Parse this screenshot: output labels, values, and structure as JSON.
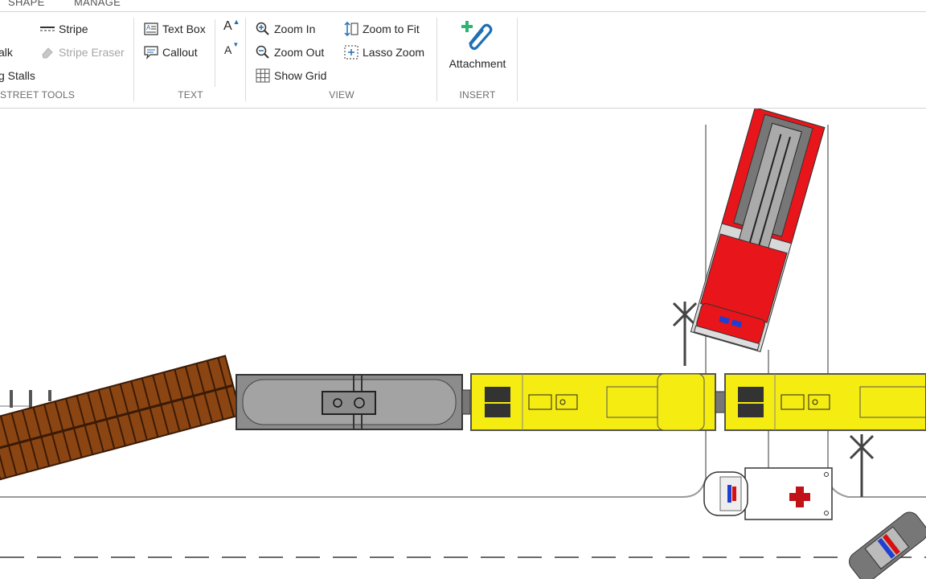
{
  "ribbon": {
    "tabs": [
      "SHAPE",
      "MANAGE"
    ],
    "street_tools": {
      "label": "STREET TOOLS",
      "items": [
        "Stripe",
        "alk",
        "Stripe Eraser",
        "g Stalls"
      ]
    },
    "text": {
      "label": "TEXT",
      "text_box": "Text Box",
      "callout": "Callout",
      "font_increase": "A",
      "font_decrease": "A"
    },
    "view": {
      "label": "VIEW",
      "zoom_in": "Zoom In",
      "zoom_out": "Zoom Out",
      "show_grid": "Show Grid",
      "zoom_to_fit": "Zoom to Fit",
      "lasso_zoom": "Lasso Zoom"
    },
    "insert": {
      "label": "INSERT",
      "attachment": "Attachment"
    }
  },
  "colors": {
    "accent_blue": "#1f6fb5",
    "add_green": "#2bb673",
    "fire_truck_red": "#e8151b",
    "train_yellow": "#f5ec12",
    "tank_car_gray": "#8c8c8c",
    "flatcar_brown": "#8b4513"
  },
  "scene": {
    "vehicles": [
      "fire-truck",
      "flatcar",
      "tank-car",
      "locomotive",
      "locomotive",
      "ambulance",
      "police-car"
    ],
    "signs": [
      "railroad-crossing-sign",
      "railroad-crossing-sign"
    ]
  }
}
